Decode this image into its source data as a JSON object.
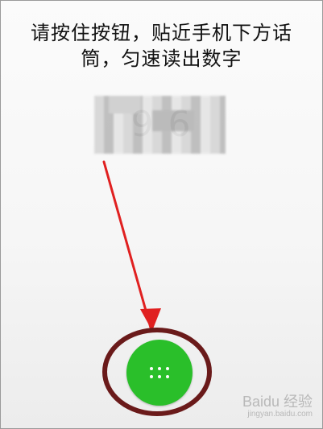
{
  "prompt": {
    "line1": "请按住按钮，贴近手机下方话",
    "line2": "筒，匀速读出数字"
  },
  "number": {
    "text": "9 6"
  },
  "mic_button": {
    "icon": "grid-dots-icon"
  },
  "watermark": {
    "brand": "Baidu 经验",
    "sub": "jingyan.baidu.com"
  },
  "colors": {
    "button_green": "#2abf2a",
    "annotation_red": "#e02020",
    "annotation_dark_red": "#6a1a1a"
  }
}
